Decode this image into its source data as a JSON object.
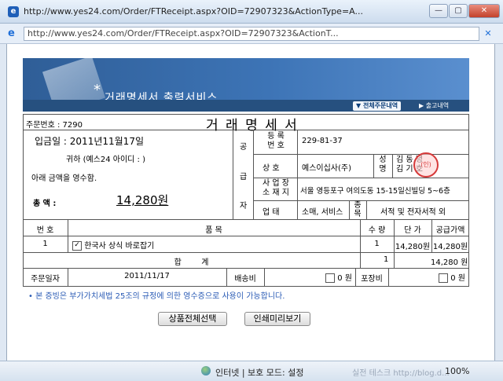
{
  "window": {
    "title": "http://www.yes24.com/Order/FTReceipt.aspx?OID=72907323&ActionType=A...",
    "address": "http://www.yes24.com/Order/FTReceipt.aspx?OID=72907323&ActionT..."
  },
  "banner": {
    "title": "거래명세서 출력서비스",
    "tab_all_orders": "▼ 전체주문내역",
    "tab_shipping": "▶ 출고내역"
  },
  "receipt": {
    "order_no": "주문번호 : 7290",
    "heading": "거 래 명 세 서",
    "deposit_date": "입금일 : 2011년11월17일",
    "to": "귀하 (예스24 아이디 :          )",
    "received_text": "아래 금액을 영수함.",
    "total_label": "총  액 :",
    "total_amount": "14,280원",
    "supplier_label": [
      "공",
      "급",
      "자"
    ],
    "reg_no_label": "등 록\n번 호",
    "reg_no": "229-81-37",
    "company_label": "상  호",
    "company": "예스이십사(주)",
    "rep_label": "성\n명",
    "rep_name": "김 동 녕\n김 기 호",
    "seal_text": "(인)",
    "address_label": "사 업 장\n소 재 지",
    "address": "서울 영등포구 여의도동 15-15일신빌딩 5~6층",
    "biz_type_label": "업  태",
    "biz_type": "소매, 서비스",
    "biz_item_label": "종\n목",
    "biz_item": "서적 및 전자서적 외",
    "col_no": "번 호",
    "col_item": "품  목",
    "col_qty": "수 량",
    "col_price": "단 가",
    "col_supply": "공급가액",
    "items": [
      {
        "no": "1",
        "name": "한국사 상식 바로잡기",
        "qty": "1",
        "price": "14,280원",
        "supply": "14,280원"
      }
    ],
    "sum_label": "합        계",
    "sum_qty": "1",
    "sum_amount": "14,280 원",
    "order_date_label": "주문일자",
    "order_date": "2011/11/17",
    "shipping_label": "배송비",
    "shipping_value": "0 원",
    "wrapping_label": "포장비",
    "wrapping_value": "0 원"
  },
  "note": "• 본 증빙은 부가가치세법 25조의 규정에 의한 영수증으로 사용이 가능합니다.",
  "buttons": {
    "select_all": "상품전체선택",
    "print_preview": "인쇄미리보기"
  },
  "status": {
    "zone": "인터넷 | 보호 모드: 설정",
    "watermark": "실전 테스크 http://blog.d...",
    "zoom": "100%"
  }
}
